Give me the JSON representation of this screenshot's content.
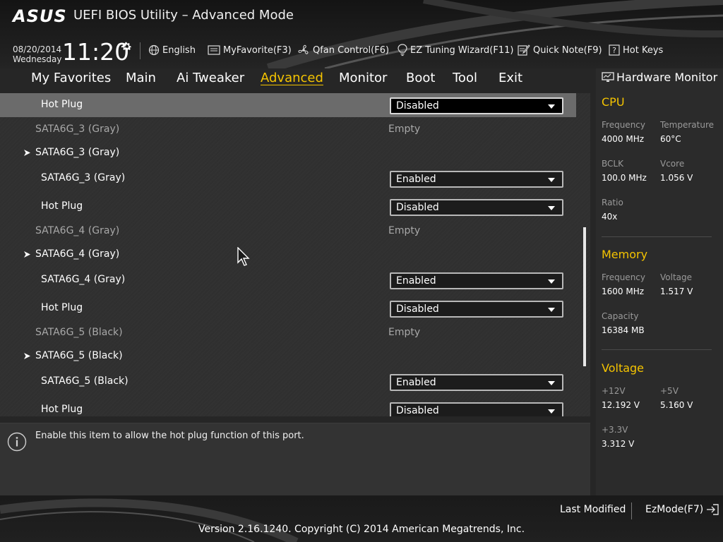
{
  "header": {
    "logo": "ASUS",
    "title": "UEFI BIOS Utility – Advanced Mode",
    "date": "08/20/2014",
    "day": "Wednesday",
    "time": "11:20",
    "tools": [
      {
        "label": "English",
        "icon": "globe-icon"
      },
      {
        "label": "MyFavorite(F3)",
        "icon": "favorite-icon"
      },
      {
        "label": "Qfan Control(F6)",
        "icon": "fan-icon"
      },
      {
        "label": "EZ Tuning Wizard(F11)",
        "icon": "bulb-icon"
      },
      {
        "label": "Quick Note(F9)",
        "icon": "note-icon"
      },
      {
        "label": "Hot Keys",
        "icon": "question-icon"
      }
    ]
  },
  "nav": {
    "active": "Advanced",
    "tabs": [
      "My Favorites",
      "Main",
      "Ai Tweaker",
      "Advanced",
      "Monitor",
      "Boot",
      "Tool",
      "Exit"
    ]
  },
  "settings": {
    "rows": [
      {
        "type": "select",
        "label": "Hot Plug",
        "value": "Disabled",
        "selected": true
      },
      {
        "type": "info",
        "label": "SATA6G_3 (Gray)",
        "value": "Empty"
      },
      {
        "type": "submenu",
        "label": "SATA6G_3 (Gray)"
      },
      {
        "type": "select",
        "label": "SATA6G_3 (Gray)",
        "value": "Enabled"
      },
      {
        "type": "select",
        "label": "Hot Plug",
        "value": "Disabled"
      },
      {
        "type": "info",
        "label": "SATA6G_4 (Gray)",
        "value": "Empty"
      },
      {
        "type": "submenu",
        "label": "SATA6G_4 (Gray)"
      },
      {
        "type": "select",
        "label": "SATA6G_4 (Gray)",
        "value": "Enabled"
      },
      {
        "type": "select",
        "label": "Hot Plug",
        "value": "Disabled"
      },
      {
        "type": "info",
        "label": "SATA6G_5 (Black)",
        "value": "Empty"
      },
      {
        "type": "submenu",
        "label": "SATA6G_5 (Black)"
      },
      {
        "type": "select",
        "label": "SATA6G_5 (Black)",
        "value": "Enabled"
      },
      {
        "type": "select",
        "label": "Hot Plug",
        "value": "Disabled"
      }
    ]
  },
  "help": {
    "text": "Enable this item to allow the hot plug function of this port."
  },
  "monitor": {
    "title": "Hardware Monitor",
    "cpu": {
      "heading": "CPU",
      "frequency_label": "Frequency",
      "frequency": "4000 MHz",
      "temperature_label": "Temperature",
      "temperature": "60°C",
      "bclk_label": "BCLK",
      "bclk": "100.0 MHz",
      "vcore_label": "Vcore",
      "vcore": "1.056 V",
      "ratio_label": "Ratio",
      "ratio": "40x"
    },
    "memory": {
      "heading": "Memory",
      "frequency_label": "Frequency",
      "frequency": "1600 MHz",
      "voltage_label": "Voltage",
      "voltage": "1.517 V",
      "capacity_label": "Capacity",
      "capacity": "16384 MB"
    },
    "voltage": {
      "heading": "Voltage",
      "v12_label": "+12V",
      "v12": "12.192 V",
      "v5_label": "+5V",
      "v5": "5.160 V",
      "v33_label": "+3.3V",
      "v33": "3.312 V"
    }
  },
  "footer": {
    "last_modified": "Last Modified",
    "ezmode": "EzMode(F7)",
    "copyright": "Version 2.16.1240. Copyright (C) 2014 American Megatrends, Inc."
  },
  "colors": {
    "accent": "#f5c400",
    "selected_row": "#6b6b6b",
    "panel": "#2b2b2b"
  }
}
